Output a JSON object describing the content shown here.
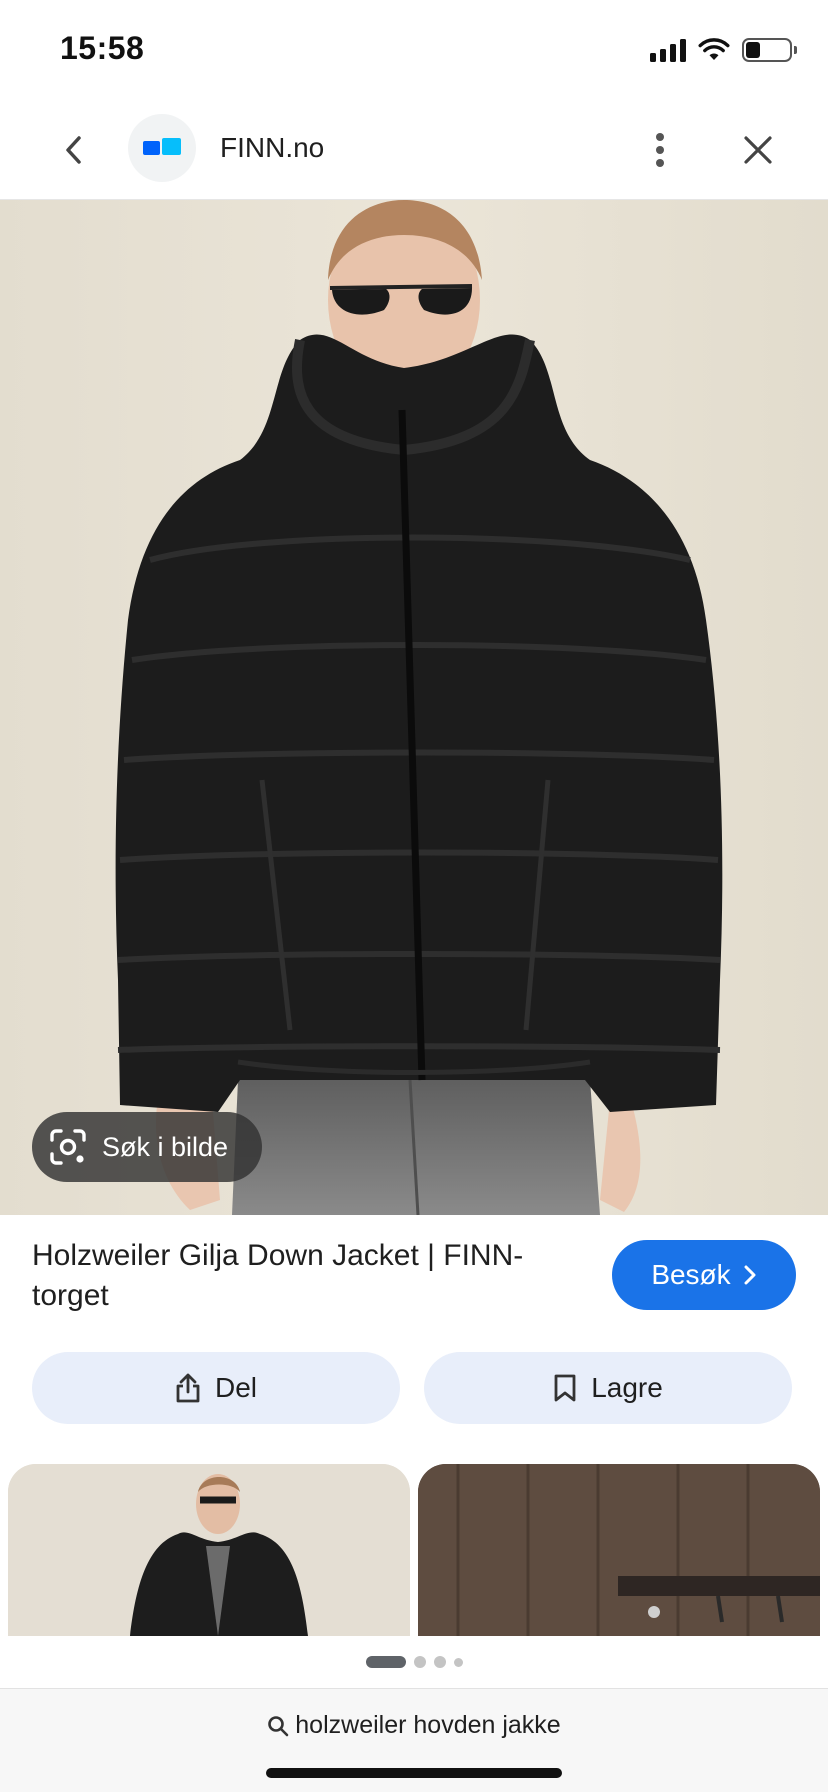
{
  "status_bar": {
    "time": "15:58",
    "icons": [
      "signal-icon",
      "wifi-icon",
      "battery-icon"
    ]
  },
  "header": {
    "back_icon": "chevron-left-icon",
    "site_logo": "finn-logo",
    "site_name": "FINN.no",
    "more_icon": "more-vert-icon",
    "close_icon": "close-icon"
  },
  "hero": {
    "image": "woman in black hooded puffer down jacket, sunglasses, grey jeans, beige backdrop",
    "lens_chip_label": "Søk i bilde",
    "lens_icon": "lens-camera-icon"
  },
  "result": {
    "title": "Holzweiler Gilja Down Jacket | FINN-torget",
    "visit_label": "Besøk",
    "visit_icon": "chevron-right-icon"
  },
  "actions": {
    "share_label": "Del",
    "share_icon": "share-icon",
    "save_label": "Lagre",
    "save_icon": "bookmark-icon"
  },
  "related_images": [
    {
      "image": "model in black puffer jacket on beige backdrop"
    },
    {
      "image": "dark wooden wall with coat hooks"
    }
  ],
  "pager": {
    "page_count": 4,
    "active_index": 0
  },
  "bottom_bar": {
    "search_icon": "search-icon",
    "query": "holzweiler hovden jakke"
  },
  "colors": {
    "accent": "#1a73e8",
    "chip_bg": "#e8eefa",
    "hero_bg": "#e7e1d3",
    "jacket": "#1c1c1c"
  }
}
